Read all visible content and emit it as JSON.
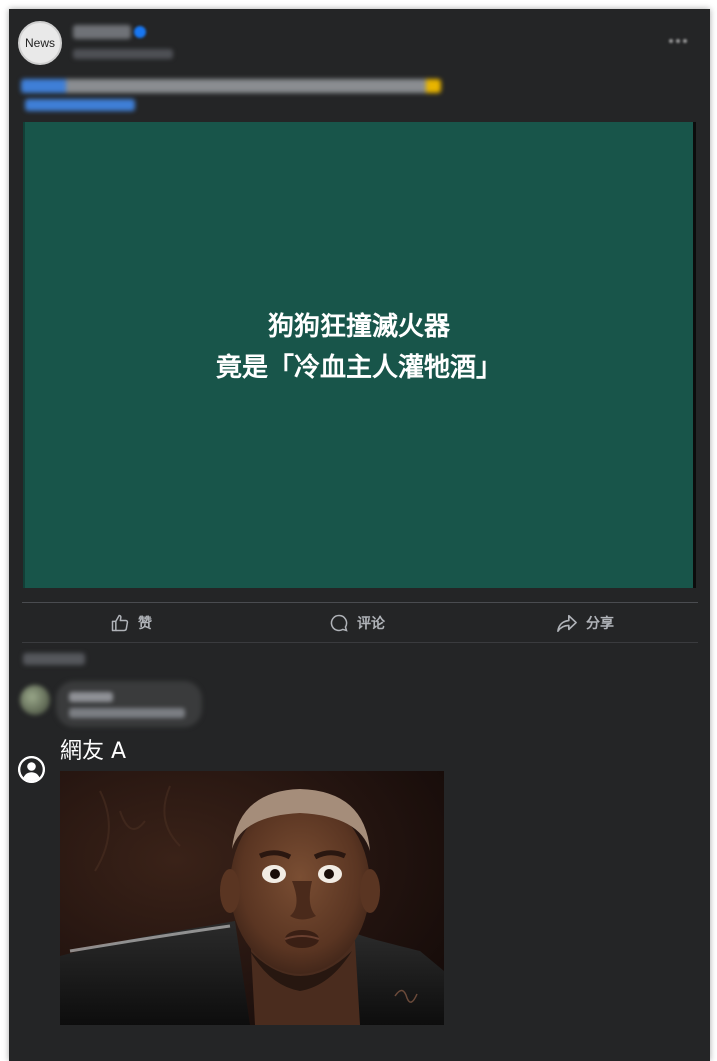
{
  "post": {
    "avatar_text": "News",
    "page_name": "",
    "meta": "",
    "caption_line1": "",
    "caption_line2": ""
  },
  "media": {
    "headline_line1": "狗狗狂撞滅火器",
    "headline_line2": "竟是「冷血主人灌牠酒」",
    "background_color": "#18554a"
  },
  "actions": {
    "like_label": "赞",
    "comment_label": "评论",
    "share_label": "分享"
  },
  "comments": {
    "sort_label": "",
    "first": {
      "name": "",
      "text": ""
    },
    "second": {
      "name": "網友 A",
      "image": "surprised-man-reaction-meme"
    }
  },
  "colors": {
    "card_background": "#242526",
    "action_text": "#b0b3b8",
    "verified_badge": "#1877f2"
  }
}
